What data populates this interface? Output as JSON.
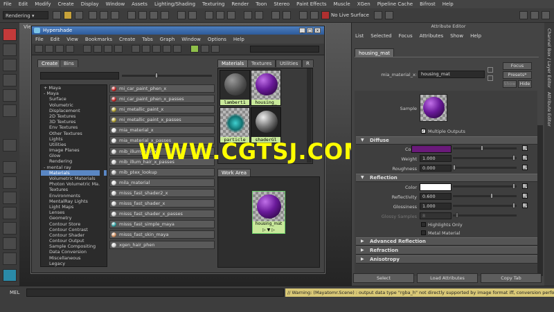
{
  "main_menu": [
    "File",
    "Edit",
    "Modify",
    "Create",
    "Display",
    "Window",
    "Assets",
    "Lighting/Shading",
    "Texturing",
    "Render",
    "Toon",
    "Stereo",
    "Paint Effects",
    "Muscle",
    "XGen",
    "Pipeline Cache",
    "Bifrost",
    "Help"
  ],
  "status_line": {
    "menu_set": "Rendering",
    "live_surface": "No Live Surface"
  },
  "viewport": {
    "menu_fragment": "Vie"
  },
  "hypershade": {
    "title": "Hypershade",
    "menu": [
      "File",
      "Edit",
      "View",
      "Bookmarks",
      "Create",
      "Tabs",
      "Graph",
      "Window",
      "Options",
      "Help"
    ],
    "left_tabs": [
      "Create",
      "Bins"
    ],
    "tree": [
      {
        "label": "+ Maya",
        "selected": false
      },
      {
        "label": "- Maya",
        "selected": false
      },
      {
        "label": "Surface",
        "selected": false
      },
      {
        "label": "Volumetric",
        "selected": false
      },
      {
        "label": "Displacement",
        "selected": false
      },
      {
        "label": "2D Textures",
        "selected": false
      },
      {
        "label": "3D Textures",
        "selected": false
      },
      {
        "label": "Env Textures",
        "selected": false
      },
      {
        "label": "Other Textures",
        "selected": false
      },
      {
        "label": "Lights",
        "selected": false
      },
      {
        "label": "Utilities",
        "selected": false
      },
      {
        "label": "Image Planes",
        "selected": false
      },
      {
        "label": "Glow",
        "selected": false
      },
      {
        "label": "Rendering",
        "selected": false
      },
      {
        "label": "- mental ray",
        "selected": false
      },
      {
        "label": "Materials",
        "selected": true
      },
      {
        "label": "Volumetric Materials",
        "selected": false
      },
      {
        "label": "Photon Volumetric Ma...",
        "selected": false
      },
      {
        "label": "Textures",
        "selected": false
      },
      {
        "label": "Environments",
        "selected": false
      },
      {
        "label": "MentalRay Lights",
        "selected": false
      },
      {
        "label": "Light Maps",
        "selected": false
      },
      {
        "label": "Lenses",
        "selected": false
      },
      {
        "label": "Geometry",
        "selected": false
      },
      {
        "label": "Contour Store",
        "selected": false
      },
      {
        "label": "Contour Contrast",
        "selected": false
      },
      {
        "label": "Contour Shader",
        "selected": false
      },
      {
        "label": "Contour Output",
        "selected": false
      },
      {
        "label": "Sample Compositing",
        "selected": false
      },
      {
        "label": "Data Conversion",
        "selected": false
      },
      {
        "label": "Miscellaneous",
        "selected": false
      },
      {
        "label": "Legacy",
        "selected": false
      }
    ],
    "nodes": [
      {
        "label": "mi_car_paint_phen_x",
        "color": "#c02020"
      },
      {
        "label": "mi_car_paint_phen_x_passes",
        "color": "#c02020"
      },
      {
        "label": "mi_metallic_paint_x",
        "color": "#b0a030"
      },
      {
        "label": "mi_metallic_paint_x_passes",
        "color": "#b0a030"
      },
      {
        "label": "mia_material_x",
        "color": "#dddddd"
      },
      {
        "label": "mia_material_x_passes",
        "color": "#dddddd"
      },
      {
        "label": "mib_illum_hair_x",
        "color": "#cccccc"
      },
      {
        "label": "mib_illum_hair_x_passes",
        "color": "#cccccc"
      },
      {
        "label": "mib_ptex_lookup",
        "color": "#bbbbbb"
      },
      {
        "label": "mila_material",
        "color": "#dddddd"
      },
      {
        "label": "misss_fast_shader2_x",
        "color": "#cccccc"
      },
      {
        "label": "misss_fast_shader_x",
        "color": "#cccccc"
      },
      {
        "label": "misss_fast_shader_x_passes",
        "color": "#cccccc"
      },
      {
        "label": "misss_fast_simple_maya",
        "color": "#30a0a0"
      },
      {
        "label": "misss_fast_skin_maya",
        "color": "#d09060"
      },
      {
        "label": "xgen_hair_phen",
        "color": "#cccccc"
      }
    ],
    "right_tabs": [
      "Materials",
      "Textures",
      "Utilities",
      "R"
    ],
    "swatches": [
      "lambert1",
      "housing_",
      "particle",
      "shaderGl"
    ],
    "work_area_tab": "Work Area",
    "work_area_node": "housing_mat"
  },
  "watermark": "WWW.CGTSJ.COM",
  "attribute_editor": {
    "title": "Attribute Editor",
    "menu": [
      "List",
      "Selected",
      "Focus",
      "Attributes",
      "Show",
      "Help"
    ],
    "node_tab": "housing_mat",
    "type_label": "mia_material_x:",
    "node_name": "housing_mat",
    "focus_label": "Focus",
    "presets_label": "Presets*",
    "show_label": "Show",
    "hide_label": "Hide",
    "sample_label": "Sample",
    "multiple_outputs": "Multiple Outputs",
    "sections": [
      {
        "title": "Diffuse",
        "expanded": true
      },
      {
        "title": "Reflection",
        "expanded": true
      },
      {
        "title": "Advanced Reflection",
        "expanded": false
      },
      {
        "title": "Refraction",
        "expanded": false
      },
      {
        "title": "Anisotropy",
        "expanded": false
      }
    ],
    "diffuse": {
      "color_label": "Color",
      "color_value": "#6a1a7a",
      "weight_label": "Weight",
      "weight_value": "1.000",
      "roughness_label": "Roughness",
      "roughness_value": "0.000"
    },
    "reflection": {
      "color_label": "Color",
      "color_value": "#ffffff",
      "reflectivity_label": "Reflectivity",
      "reflectivity_value": "0.600",
      "glossiness_label": "Glossiness",
      "glossiness_value": "1.000",
      "glossy_samples_label": "Glossy Samples",
      "glossy_samples_value": "8",
      "highlights_only": "Highlights Only",
      "metal_material": "Metal Material"
    },
    "buttons": {
      "select": "Select",
      "load": "Load Attributes",
      "copy_tab": "Copy Tab"
    }
  },
  "side_strip": {
    "channel_box": "Channel Box / Layer Editor",
    "attribute_editor": "Attribute Editor"
  },
  "command_line": {
    "label": "MEL",
    "warning": "// Warning: (Mayatomr.Scene) : output data type \"rgba_h\" not directly supported by image format iff, conversion performed"
  }
}
